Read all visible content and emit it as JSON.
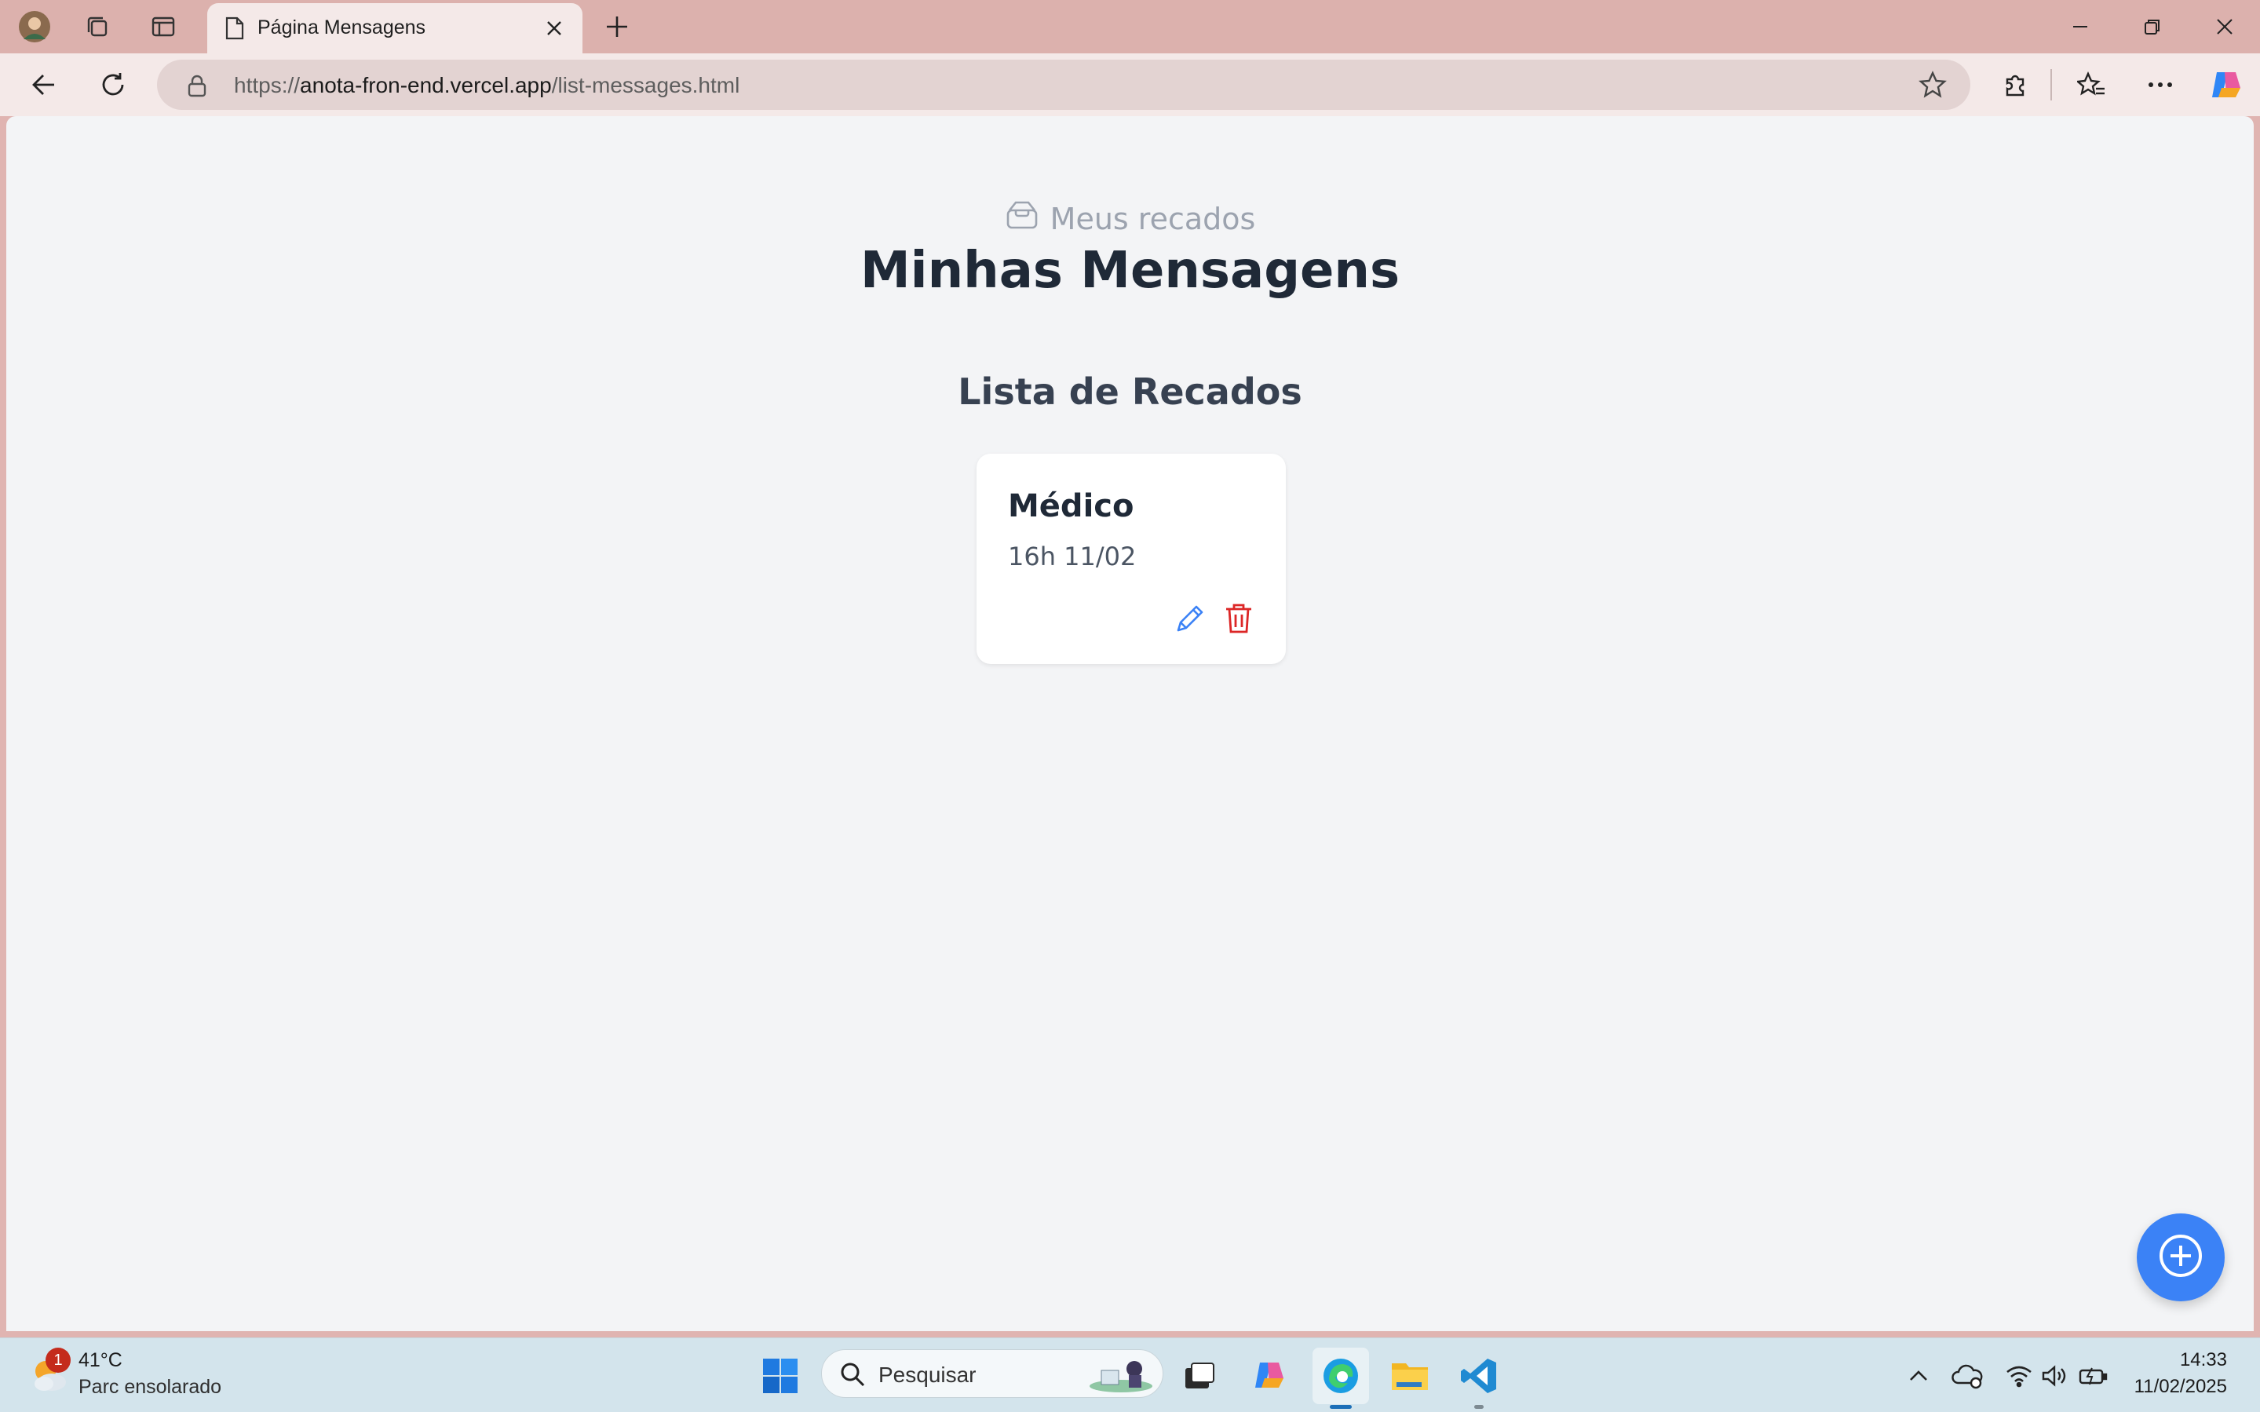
{
  "browser": {
    "tab_title": "Página Mensagens",
    "address_prefix": "https://",
    "address_host": "anota-fron-end.vercel.app",
    "address_path": "/list-messages.html"
  },
  "page": {
    "eyebrow": "Meus recados",
    "title": "Minhas Mensagens",
    "list_title": "Lista de Recados",
    "messages": [
      {
        "title": "Médico",
        "detail": "16h 11/02"
      }
    ]
  },
  "taskbar": {
    "weather_badge": "1",
    "weather_temp": "41°C",
    "weather_desc": "Parc ensolarado",
    "search_placeholder": "Pesquisar",
    "time": "14:33",
    "date": "11/02/2025"
  },
  "colors": {
    "accent": "#3b82f6",
    "delete": "#dc2626",
    "edit": "#3b82f6",
    "page_bg": "#f3f4f6",
    "title": "#1f2937"
  }
}
